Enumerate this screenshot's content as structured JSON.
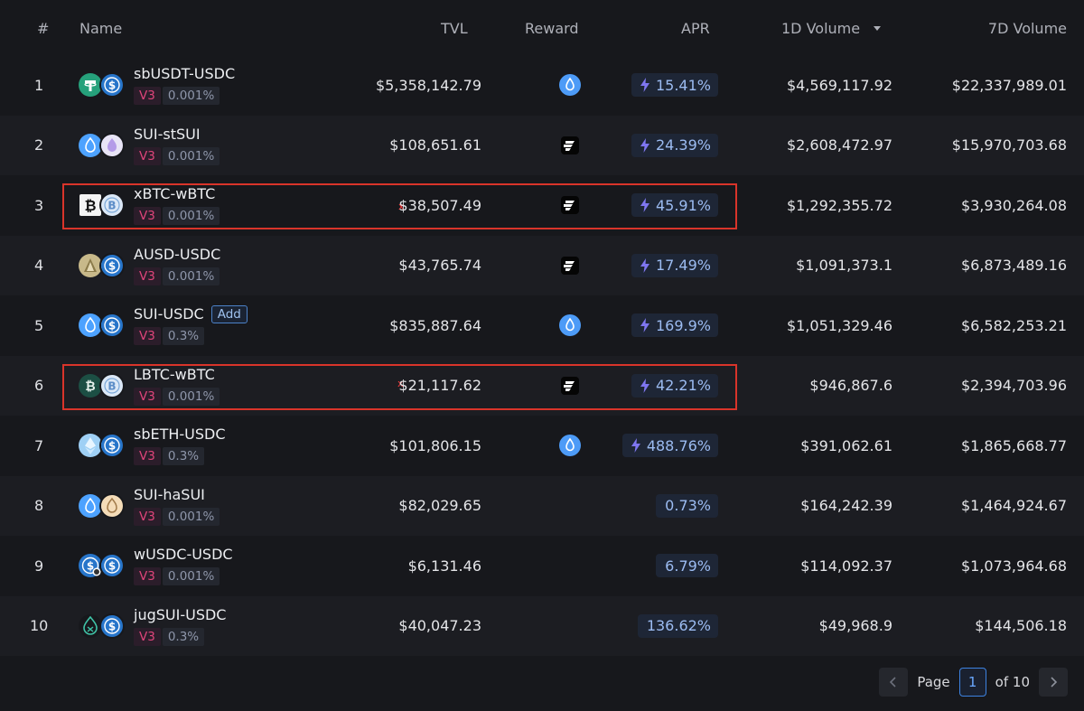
{
  "headers": {
    "num": "#",
    "name": "Name",
    "tvl": "TVL",
    "reward": "Reward",
    "apr": "APR",
    "vol1d": "1D Volume",
    "vol7d": "7D Volume",
    "sort_icon": "caret-down-icon"
  },
  "rows": [
    {
      "rank": "1",
      "pair": "sbUSDT-USDC",
      "version": "V3",
      "fee": "0.001%",
      "tvl": "$5,358,142.79",
      "reward": "sui-drop-icon",
      "apr": "15.41%",
      "apr_boosted": true,
      "vol1d": "$4,569,117.92",
      "vol7d": "$22,337,989.01",
      "tokens": [
        "tether-icon",
        "usdc-icon"
      ]
    },
    {
      "rank": "2",
      "pair": "SUI-stSUI",
      "version": "V3",
      "fee": "0.001%",
      "tvl": "$108,651.61",
      "reward": "stripe-logo-icon",
      "apr": "24.39%",
      "apr_boosted": true,
      "vol1d": "$2,608,472.97",
      "vol7d": "$15,970,703.68",
      "tokens": [
        "sui-icon",
        "stsui-icon"
      ]
    },
    {
      "rank": "3",
      "pair": "xBTC-wBTC",
      "version": "V3",
      "fee": "0.001%",
      "tvl": "$38,507.49",
      "reward": "stripe-logo-icon",
      "apr": "45.91%",
      "apr_boosted": true,
      "vol1d": "$1,292,355.72",
      "vol7d": "$3,930,264.08",
      "tokens": [
        "xbtc-icon",
        "wbtc-icon"
      ],
      "flag": "x"
    },
    {
      "rank": "4",
      "pair": "AUSD-USDC",
      "version": "V3",
      "fee": "0.001%",
      "tvl": "$43,765.74",
      "reward": "stripe-logo-icon",
      "apr": "17.49%",
      "apr_boosted": true,
      "vol1d": "$1,091,373.1",
      "vol7d": "$6,873,489.16",
      "tokens": [
        "ausd-icon",
        "usdc-icon"
      ]
    },
    {
      "rank": "5",
      "pair": "SUI-USDC",
      "add_label": "Add",
      "version": "V3",
      "fee": "0.3%",
      "tvl": "$835,887.64",
      "reward": "sui-drop-icon",
      "apr": "169.9%",
      "apr_boosted": true,
      "vol1d": "$1,051,329.46",
      "vol7d": "$6,582,253.21",
      "tokens": [
        "sui-icon",
        "usdc-icon"
      ]
    },
    {
      "rank": "6",
      "pair": "LBTC-wBTC",
      "version": "V3",
      "fee": "0.001%",
      "tvl": "$21,117.62",
      "reward": "stripe-logo-icon",
      "apr": "42.21%",
      "apr_boosted": true,
      "vol1d": "$946,867.6",
      "vol7d": "$2,394,703.96",
      "tokens": [
        "lbtc-icon",
        "wbtc-icon"
      ],
      "flag": "x"
    },
    {
      "rank": "7",
      "pair": "sbETH-USDC",
      "version": "V3",
      "fee": "0.3%",
      "tvl": "$101,806.15",
      "reward": "sui-drop-icon",
      "apr": "488.76%",
      "apr_boosted": true,
      "vol1d": "$391,062.61",
      "vol7d": "$1,865,668.77",
      "tokens": [
        "eth-icon",
        "usdc-icon"
      ]
    },
    {
      "rank": "8",
      "pair": "SUI-haSUI",
      "version": "V3",
      "fee": "0.001%",
      "tvl": "$82,029.65",
      "reward": "",
      "apr": "0.73%",
      "apr_boosted": false,
      "vol1d": "$164,242.39",
      "vol7d": "$1,464,924.67",
      "tokens": [
        "sui-icon",
        "hasui-icon"
      ]
    },
    {
      "rank": "9",
      "pair": "wUSDC-USDC",
      "version": "V3",
      "fee": "0.001%",
      "tvl": "$6,131.46",
      "reward": "",
      "apr": "6.79%",
      "apr_boosted": false,
      "vol1d": "$114,092.37",
      "vol7d": "$1,073,964.68",
      "tokens": [
        "wusdc-icon",
        "usdc-icon"
      ]
    },
    {
      "rank": "10",
      "pair": "jugSUI-USDC",
      "version": "V3",
      "fee": "0.3%",
      "tvl": "$40,047.23",
      "reward": "",
      "apr": "136.62%",
      "apr_boosted": false,
      "vol1d": "$49,968.9",
      "vol7d": "$144,506.18",
      "tokens": [
        "jugsui-icon",
        "usdc-icon"
      ]
    }
  ],
  "highlighted_rows": [
    "3",
    "6"
  ],
  "pagination": {
    "prev_icon": "chevron-left-icon",
    "label": "Page",
    "current": "1",
    "of_label": "of 10",
    "next_icon": "chevron-right-icon"
  },
  "colors": {
    "background": "#17181c",
    "accent_blue": "#4d9bf7",
    "apr_text": "#9cbcf2",
    "version_tag": "#e0457b",
    "highlight_box": "#d9342a"
  }
}
